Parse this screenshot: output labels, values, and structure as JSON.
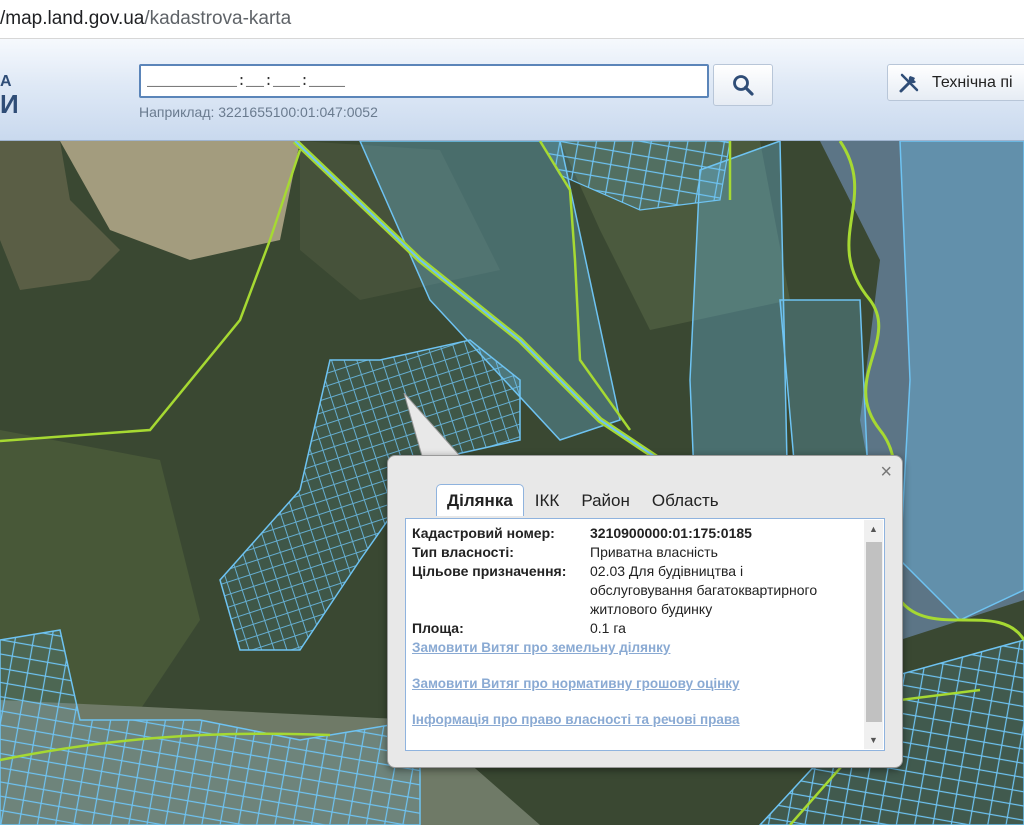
{
  "browser": {
    "url_host": "/map.land.gov.ua",
    "url_path": "/kadastrova-karta"
  },
  "header": {
    "logo_line1": "А",
    "logo_line2": "И",
    "search_value": "__________:__:___:____",
    "search_example": "Наприклад: 3221655100:01:047:0052",
    "tech_button_label": "Технічна пі"
  },
  "popup": {
    "close_label": "×",
    "tabs": [
      {
        "label": "Ділянка",
        "active": true
      },
      {
        "label": "ІКК",
        "active": false
      },
      {
        "label": "Район",
        "active": false
      },
      {
        "label": "Область",
        "active": false
      }
    ],
    "fields": [
      {
        "key": "Кадастровий номер:",
        "value": "3210900000:01:175:0185"
      },
      {
        "key": "Тип власності:",
        "value": "Приватна власність"
      },
      {
        "key": "Цільове призначення:",
        "value": "02.03 Для будівництва і обслуговування багатоквартирного житлового будинку"
      },
      {
        "key": "Площа:",
        "value": "0.1 га"
      }
    ],
    "links": [
      "Замовити Витяг про земельну ділянку",
      "Замовити Витяг про нормативну грошову оцінку",
      "Інформація про право власності та речові права"
    ]
  },
  "colors": {
    "parcel": "#6ec3f2",
    "boundary": "#a6d932",
    "forest": "#3a4832",
    "clearing": "#a39c7e"
  }
}
